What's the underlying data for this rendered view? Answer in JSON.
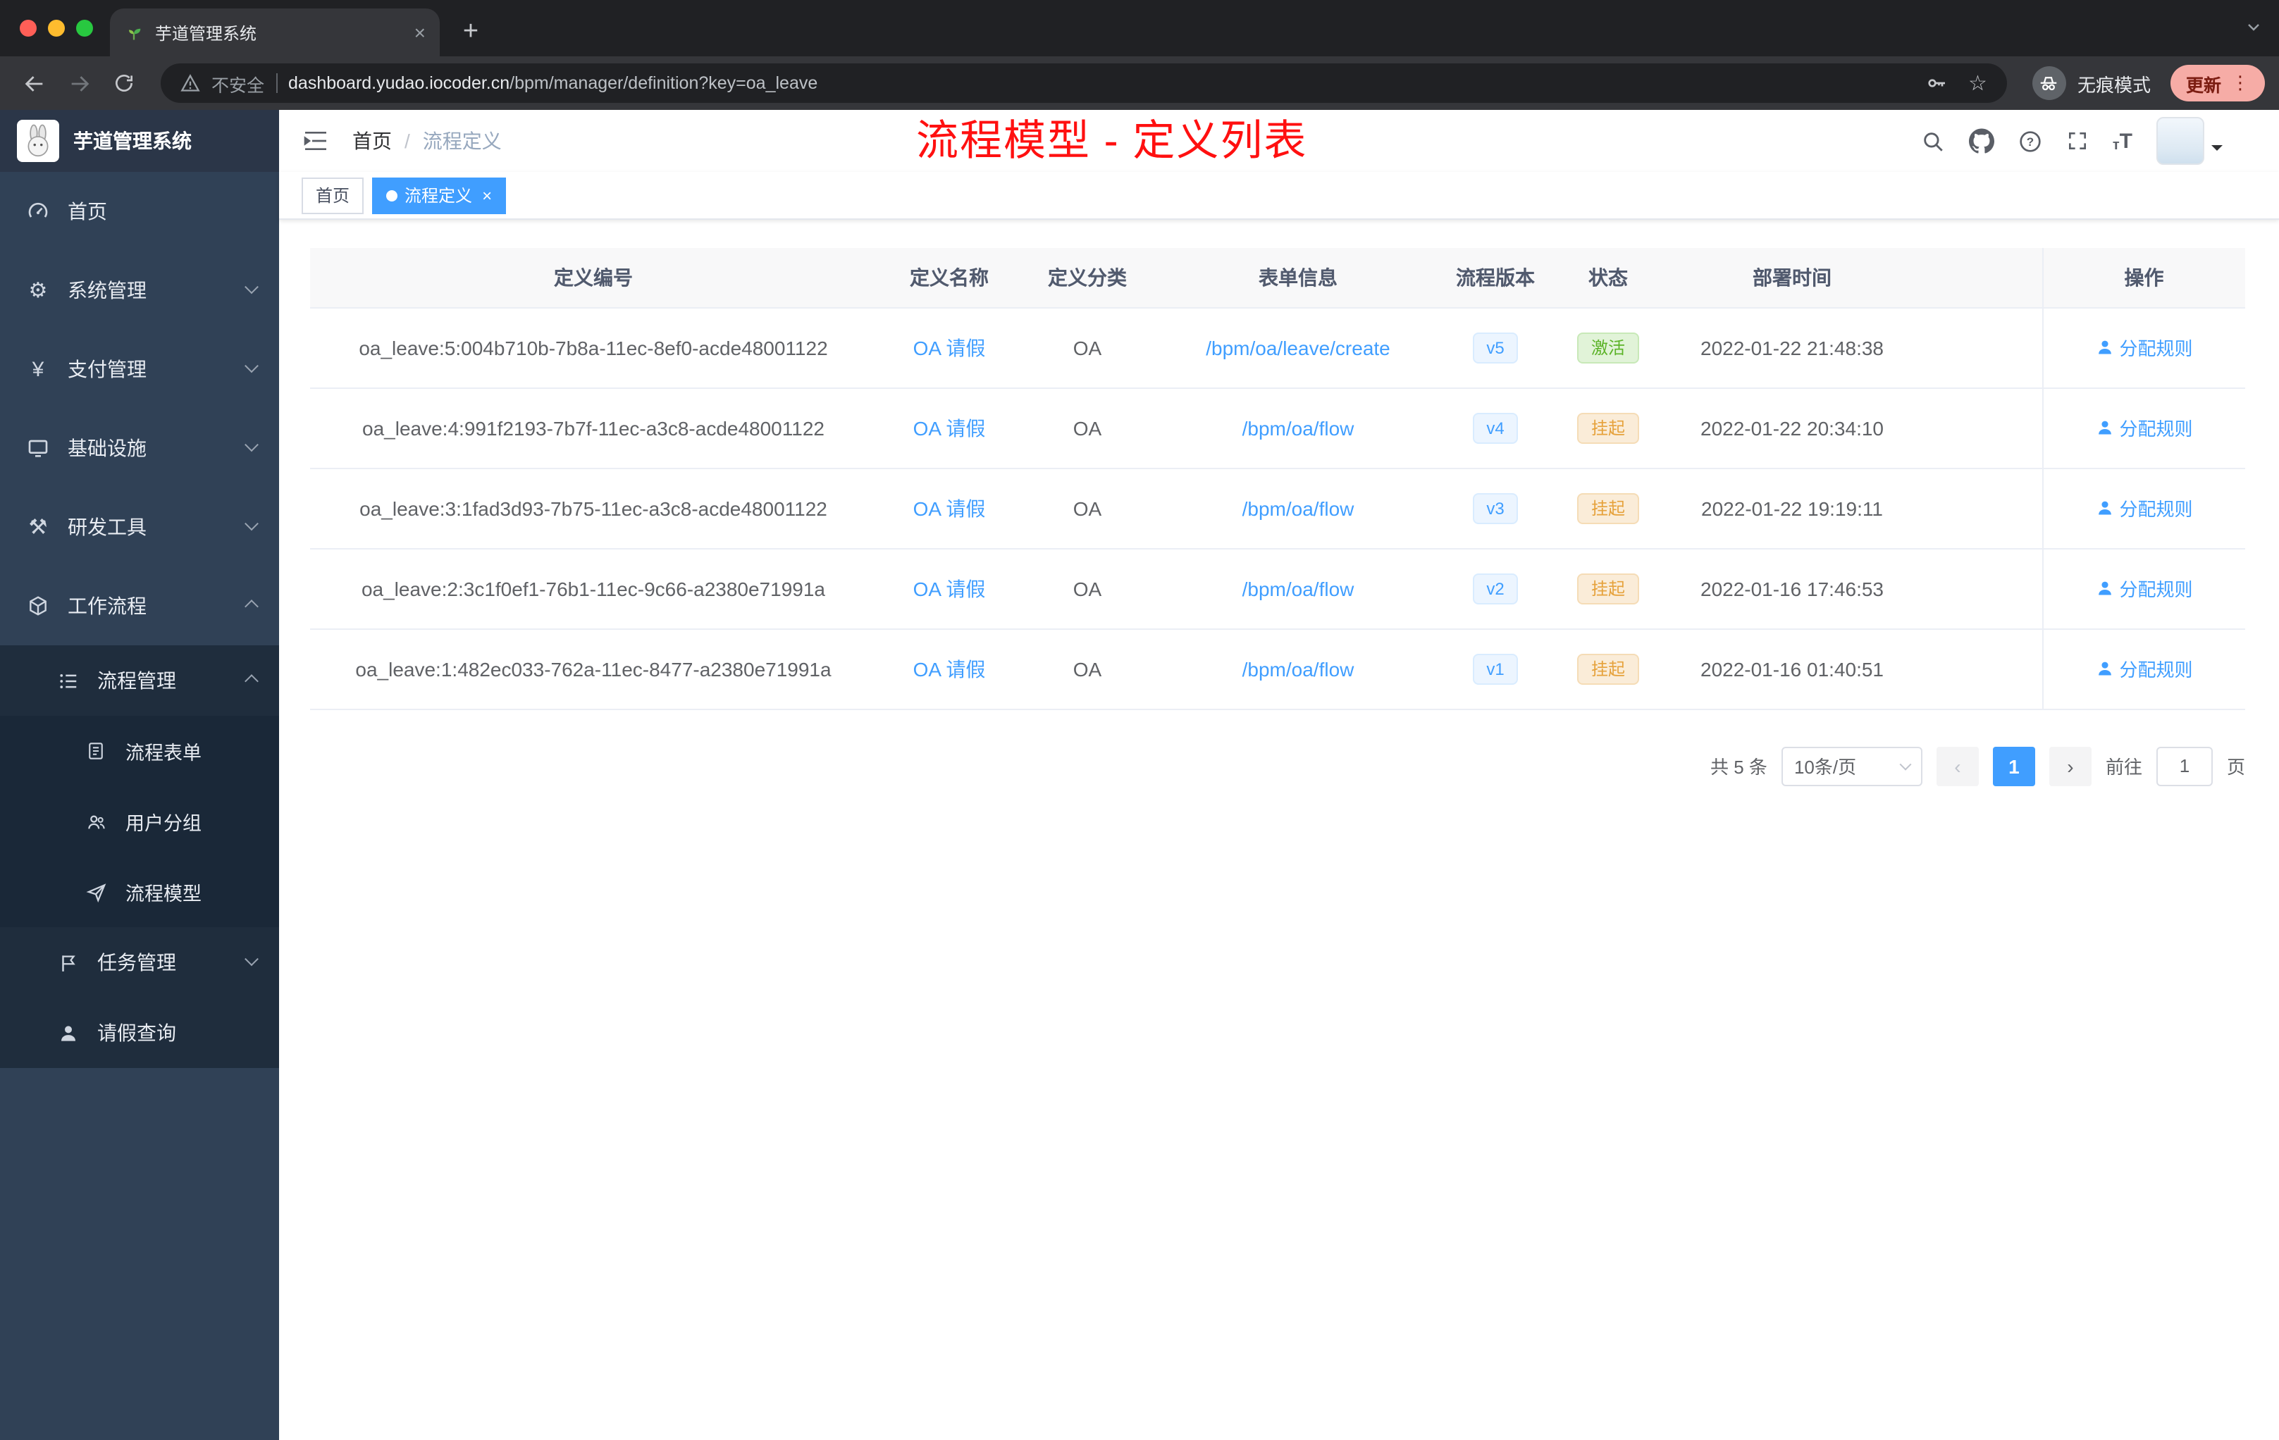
{
  "browser": {
    "tab_title": "芋道管理系统",
    "security_label": "不安全",
    "url_host": "dashboard.yudao.iocoder.cn",
    "url_path": "/bpm/manager/definition?key=oa_leave",
    "incognito_label": "无痕模式",
    "update_label": "更新"
  },
  "sidebar": {
    "logo_title": "芋道管理系统",
    "items": [
      {
        "label": "首页"
      },
      {
        "label": "系统管理"
      },
      {
        "label": "支付管理"
      },
      {
        "label": "基础设施"
      },
      {
        "label": "研发工具"
      },
      {
        "label": "工作流程"
      },
      {
        "label": "流程管理"
      },
      {
        "label": "流程表单"
      },
      {
        "label": "用户分组"
      },
      {
        "label": "流程模型"
      },
      {
        "label": "任务管理"
      },
      {
        "label": "请假查询"
      }
    ]
  },
  "header": {
    "breadcrumb_home": "首页",
    "breadcrumb_sep": "/",
    "breadcrumb_current": "流程定义",
    "annotation": "流程模型 - 定义列表"
  },
  "tags": {
    "home": "首页",
    "current": "流程定义"
  },
  "table": {
    "columns": [
      "定义编号",
      "定义名称",
      "定义分类",
      "表单信息",
      "流程版本",
      "状态",
      "部署时间",
      "操作"
    ],
    "rows": [
      {
        "id": "oa_leave:5:004b710b-7b8a-11ec-8ef0-acde48001122",
        "name": "OA 请假",
        "category": "OA",
        "form": "/bpm/oa/leave/create",
        "version": "v5",
        "status": "激活",
        "status_type": "success",
        "time": "2022-01-22 21:48:38",
        "action": "分配规则"
      },
      {
        "id": "oa_leave:4:991f2193-7b7f-11ec-a3c8-acde48001122",
        "name": "OA 请假",
        "category": "OA",
        "form": "/bpm/oa/flow",
        "version": "v4",
        "status": "挂起",
        "status_type": "warning",
        "time": "2022-01-22 20:34:10",
        "action": "分配规则"
      },
      {
        "id": "oa_leave:3:1fad3d93-7b75-11ec-a3c8-acde48001122",
        "name": "OA 请假",
        "category": "OA",
        "form": "/bpm/oa/flow",
        "version": "v3",
        "status": "挂起",
        "status_type": "warning",
        "time": "2022-01-22 19:19:11",
        "action": "分配规则"
      },
      {
        "id": "oa_leave:2:3c1f0ef1-76b1-11ec-9c66-a2380e71991a",
        "name": "OA 请假",
        "category": "OA",
        "form": "/bpm/oa/flow",
        "version": "v2",
        "status": "挂起",
        "status_type": "warning",
        "time": "2022-01-16 17:46:53",
        "action": "分配规则"
      },
      {
        "id": "oa_leave:1:482ec033-762a-11ec-8477-a2380e71991a",
        "name": "OA 请假",
        "category": "OA",
        "form": "/bpm/oa/flow",
        "version": "v1",
        "status": "挂起",
        "status_type": "warning",
        "time": "2022-01-16 01:40:51",
        "action": "分配规则"
      }
    ]
  },
  "pagination": {
    "total": "共 5 条",
    "page_size": "10条/页",
    "current_page": "1",
    "goto_label": "前往",
    "goto_value": "1",
    "unit_label": "页"
  },
  "icons": {
    "gear": "⚙",
    "yen": "¥",
    "tools": "⚒",
    "help": "?",
    "size_small": "т",
    "size_large": "T",
    "star": "☆",
    "menu_dots": "⋮",
    "new_tab_plus": "+",
    "tab_close": "×",
    "tag_close": "×",
    "prev_arrow": "‹",
    "next_arrow": "›"
  }
}
